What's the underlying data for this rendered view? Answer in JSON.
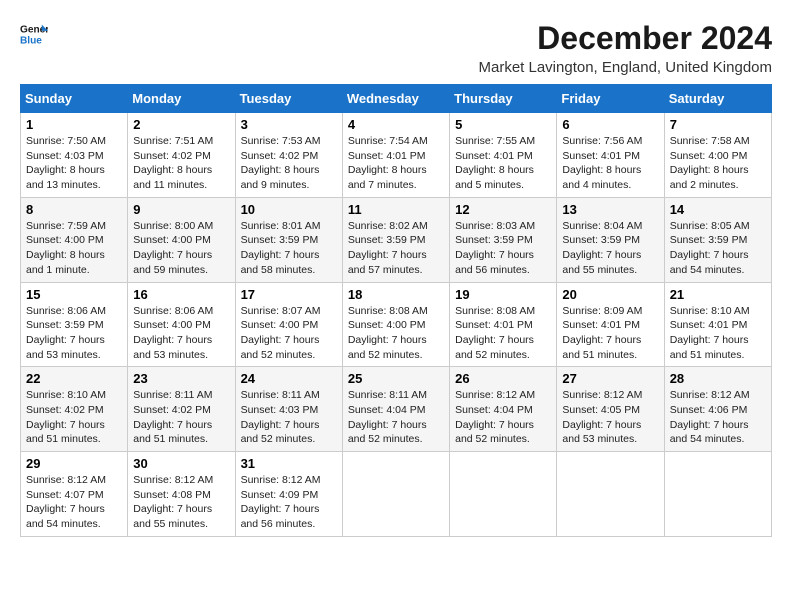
{
  "logo": {
    "line1": "General",
    "line2": "Blue"
  },
  "title": "December 2024",
  "location": "Market Lavington, England, United Kingdom",
  "header_color": "#1a73c8",
  "days_of_week": [
    "Sunday",
    "Monday",
    "Tuesday",
    "Wednesday",
    "Thursday",
    "Friday",
    "Saturday"
  ],
  "weeks": [
    [
      {
        "day": "1",
        "sunrise": "7:50 AM",
        "sunset": "4:03 PM",
        "daylight": "8 hours and 13 minutes."
      },
      {
        "day": "2",
        "sunrise": "7:51 AM",
        "sunset": "4:02 PM",
        "daylight": "8 hours and 11 minutes."
      },
      {
        "day": "3",
        "sunrise": "7:53 AM",
        "sunset": "4:02 PM",
        "daylight": "8 hours and 9 minutes."
      },
      {
        "day": "4",
        "sunrise": "7:54 AM",
        "sunset": "4:01 PM",
        "daylight": "8 hours and 7 minutes."
      },
      {
        "day": "5",
        "sunrise": "7:55 AM",
        "sunset": "4:01 PM",
        "daylight": "8 hours and 5 minutes."
      },
      {
        "day": "6",
        "sunrise": "7:56 AM",
        "sunset": "4:01 PM",
        "daylight": "8 hours and 4 minutes."
      },
      {
        "day": "7",
        "sunrise": "7:58 AM",
        "sunset": "4:00 PM",
        "daylight": "8 hours and 2 minutes."
      }
    ],
    [
      {
        "day": "8",
        "sunrise": "7:59 AM",
        "sunset": "4:00 PM",
        "daylight": "8 hours and 1 minute."
      },
      {
        "day": "9",
        "sunrise": "8:00 AM",
        "sunset": "4:00 PM",
        "daylight": "7 hours and 59 minutes."
      },
      {
        "day": "10",
        "sunrise": "8:01 AM",
        "sunset": "3:59 PM",
        "daylight": "7 hours and 58 minutes."
      },
      {
        "day": "11",
        "sunrise": "8:02 AM",
        "sunset": "3:59 PM",
        "daylight": "7 hours and 57 minutes."
      },
      {
        "day": "12",
        "sunrise": "8:03 AM",
        "sunset": "3:59 PM",
        "daylight": "7 hours and 56 minutes."
      },
      {
        "day": "13",
        "sunrise": "8:04 AM",
        "sunset": "3:59 PM",
        "daylight": "7 hours and 55 minutes."
      },
      {
        "day": "14",
        "sunrise": "8:05 AM",
        "sunset": "3:59 PM",
        "daylight": "7 hours and 54 minutes."
      }
    ],
    [
      {
        "day": "15",
        "sunrise": "8:06 AM",
        "sunset": "3:59 PM",
        "daylight": "7 hours and 53 minutes."
      },
      {
        "day": "16",
        "sunrise": "8:06 AM",
        "sunset": "4:00 PM",
        "daylight": "7 hours and 53 minutes."
      },
      {
        "day": "17",
        "sunrise": "8:07 AM",
        "sunset": "4:00 PM",
        "daylight": "7 hours and 52 minutes."
      },
      {
        "day": "18",
        "sunrise": "8:08 AM",
        "sunset": "4:00 PM",
        "daylight": "7 hours and 52 minutes."
      },
      {
        "day": "19",
        "sunrise": "8:08 AM",
        "sunset": "4:01 PM",
        "daylight": "7 hours and 52 minutes."
      },
      {
        "day": "20",
        "sunrise": "8:09 AM",
        "sunset": "4:01 PM",
        "daylight": "7 hours and 51 minutes."
      },
      {
        "day": "21",
        "sunrise": "8:10 AM",
        "sunset": "4:01 PM",
        "daylight": "7 hours and 51 minutes."
      }
    ],
    [
      {
        "day": "22",
        "sunrise": "8:10 AM",
        "sunset": "4:02 PM",
        "daylight": "7 hours and 51 minutes."
      },
      {
        "day": "23",
        "sunrise": "8:11 AM",
        "sunset": "4:02 PM",
        "daylight": "7 hours and 51 minutes."
      },
      {
        "day": "24",
        "sunrise": "8:11 AM",
        "sunset": "4:03 PM",
        "daylight": "7 hours and 52 minutes."
      },
      {
        "day": "25",
        "sunrise": "8:11 AM",
        "sunset": "4:04 PM",
        "daylight": "7 hours and 52 minutes."
      },
      {
        "day": "26",
        "sunrise": "8:12 AM",
        "sunset": "4:04 PM",
        "daylight": "7 hours and 52 minutes."
      },
      {
        "day": "27",
        "sunrise": "8:12 AM",
        "sunset": "4:05 PM",
        "daylight": "7 hours and 53 minutes."
      },
      {
        "day": "28",
        "sunrise": "8:12 AM",
        "sunset": "4:06 PM",
        "daylight": "7 hours and 54 minutes."
      }
    ],
    [
      {
        "day": "29",
        "sunrise": "8:12 AM",
        "sunset": "4:07 PM",
        "daylight": "7 hours and 54 minutes."
      },
      {
        "day": "30",
        "sunrise": "8:12 AM",
        "sunset": "4:08 PM",
        "daylight": "7 hours and 55 minutes."
      },
      {
        "day": "31",
        "sunrise": "8:12 AM",
        "sunset": "4:09 PM",
        "daylight": "7 hours and 56 minutes."
      },
      null,
      null,
      null,
      null
    ]
  ],
  "labels": {
    "sunrise_prefix": "Sunrise: ",
    "sunset_prefix": "Sunset: ",
    "daylight_prefix": "Daylight: "
  }
}
